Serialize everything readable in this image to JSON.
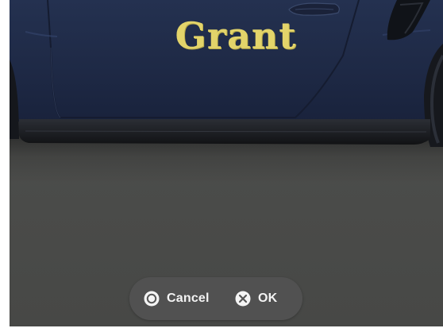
{
  "livery": {
    "car_lettering": "Grant",
    "lettering_color": "#e3d46a",
    "body_color": "#1f2a45"
  },
  "dialog": {
    "cancel": {
      "label": "Cancel",
      "icon": "circle-button-icon"
    },
    "ok": {
      "label": "OK",
      "icon": "cross-button-icon"
    }
  }
}
